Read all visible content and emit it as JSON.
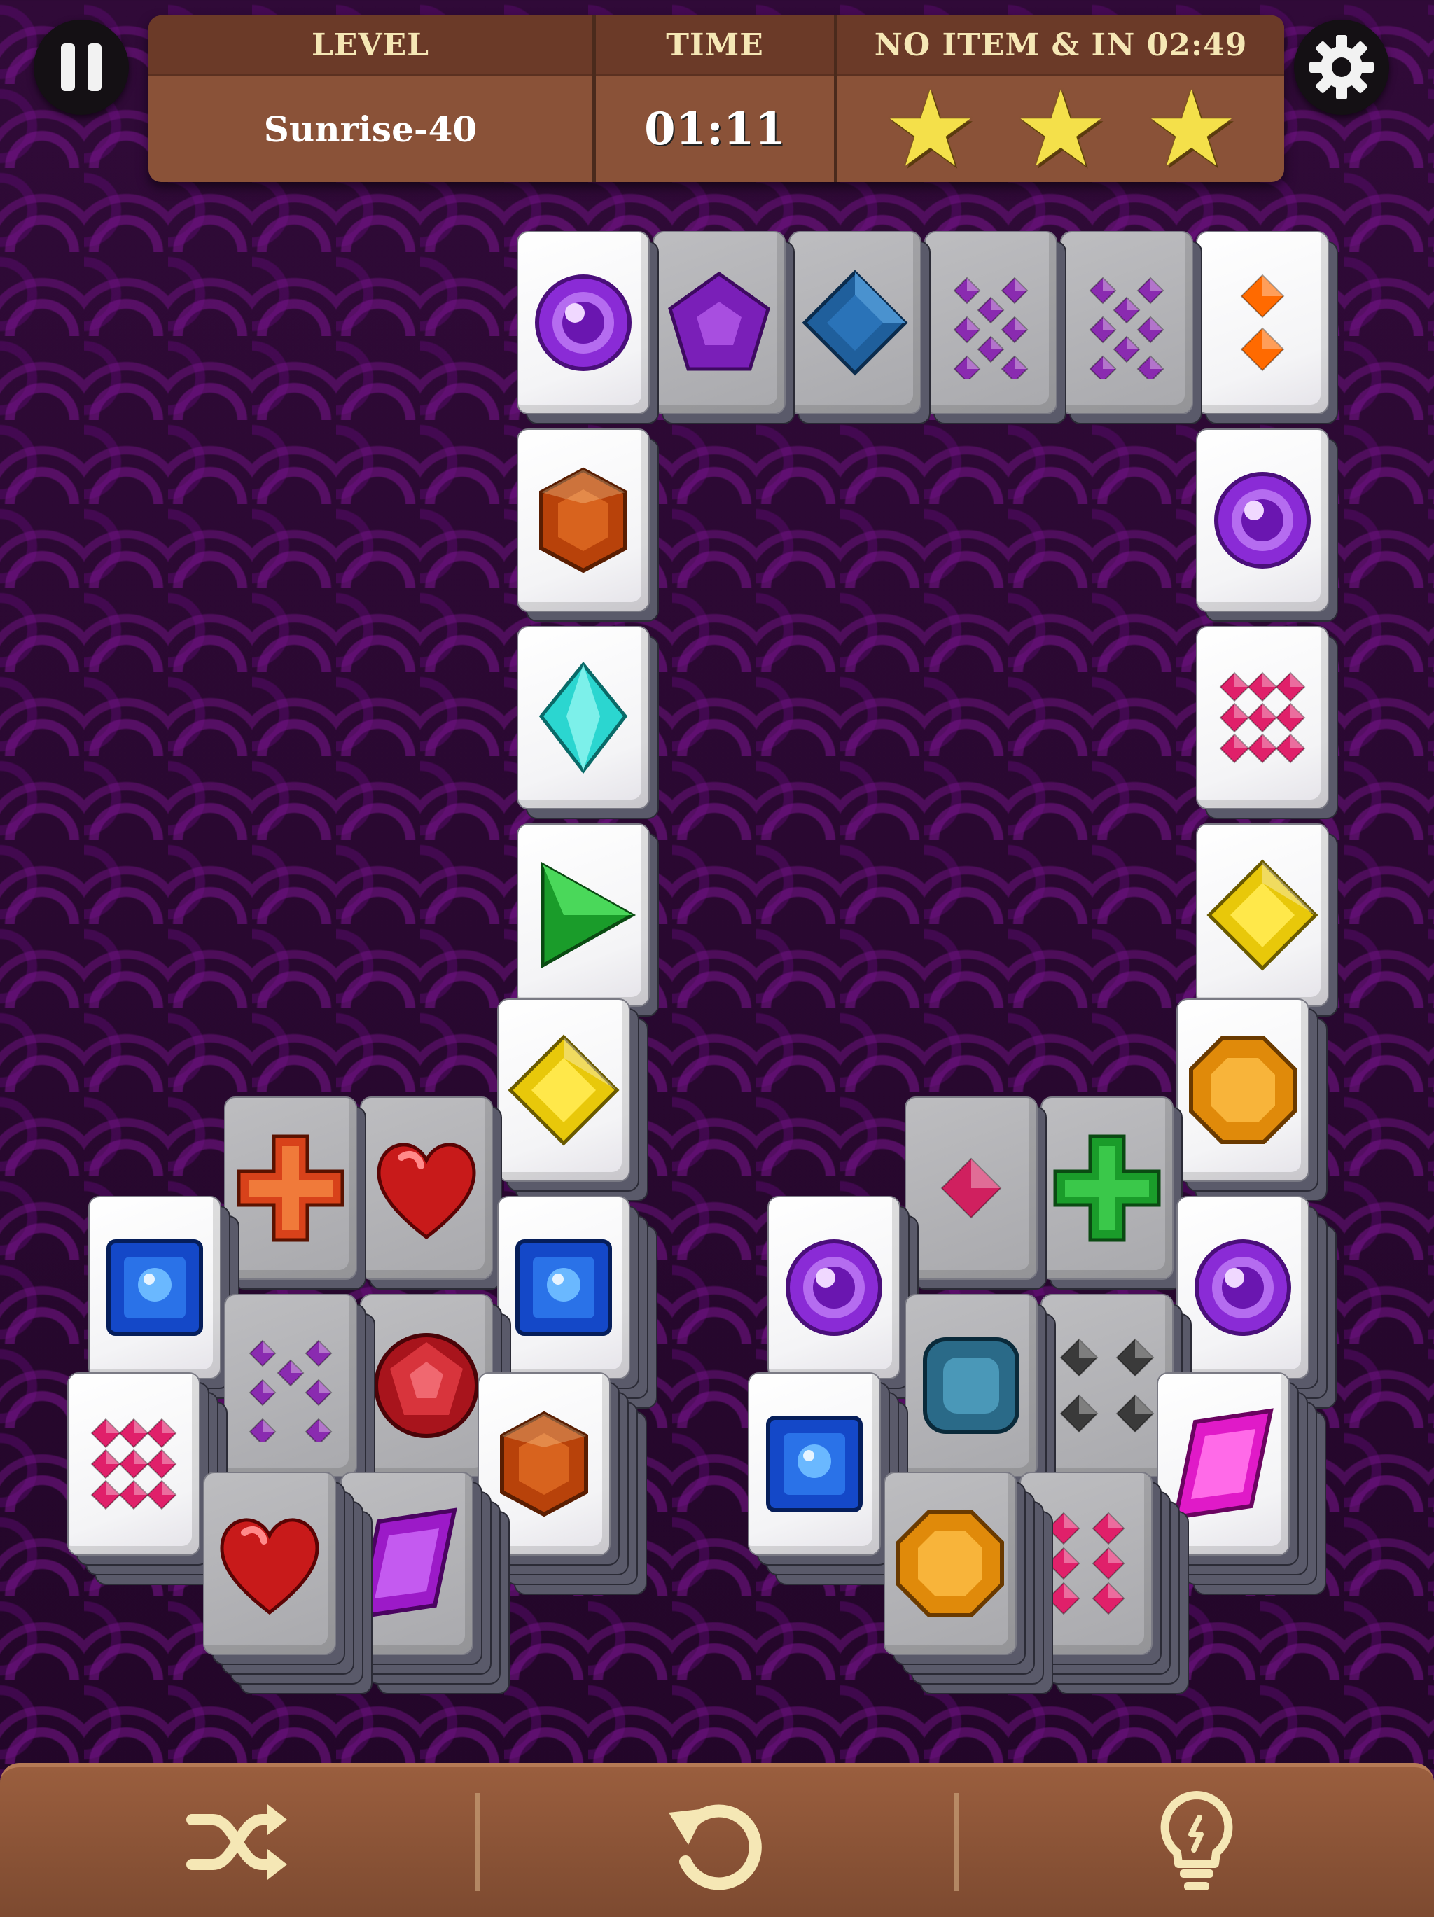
{
  "hud": {
    "level_label": "LEVEL",
    "level_value": "Sunrise-40",
    "time_label": "TIME",
    "time_value": "01:11",
    "goal_label": "NO ITEM & IN 02:49",
    "stars_earned": 3
  },
  "icons": {
    "pause": "pause-icon",
    "settings": "gear-icon",
    "shuffle": "shuffle-icon",
    "undo": "undo-icon",
    "hint": "lightbulb-icon"
  },
  "colors": {
    "hud_bg": "#8a5238",
    "hud_header": "#6b3a28",
    "star": "#f4e04a",
    "toolbar": "#8a5238",
    "toolbar_icon": "#f5e7b5",
    "background": "#2a0a30"
  },
  "board": {
    "tiles": [
      {
        "gem": "purple-orb",
        "state": "free",
        "depth": 1
      },
      {
        "gem": "purple-pentagon",
        "state": "blocked",
        "depth": 1
      },
      {
        "gem": "blue-diamond",
        "state": "blocked",
        "depth": 1
      },
      {
        "gem": "purple-dots-8",
        "state": "blocked",
        "depth": 1
      },
      {
        "gem": "purple-dots-8",
        "state": "blocked",
        "depth": 1
      },
      {
        "gem": "orange-dots-2",
        "state": "free",
        "depth": 1
      },
      {
        "gem": "orange-hexagon",
        "state": "free",
        "depth": 1
      },
      {
        "gem": "purple-orb",
        "state": "free",
        "depth": 1
      },
      {
        "gem": "cyan-crystal",
        "state": "free",
        "depth": 1
      },
      {
        "gem": "pink-dots-9",
        "state": "free",
        "depth": 1
      },
      {
        "gem": "green-triangle",
        "state": "free",
        "depth": 1
      },
      {
        "gem": "yellow-diamond",
        "state": "free",
        "depth": 1
      },
      {
        "gem": "yellow-diamond",
        "state": "free",
        "depth": 2
      },
      {
        "gem": "amber-octagon",
        "state": "free",
        "depth": 2
      },
      {
        "gem": "red-cross",
        "state": "blocked",
        "depth": 1
      },
      {
        "gem": "red-heart",
        "state": "blocked",
        "depth": 1
      },
      {
        "gem": "blue-square",
        "state": "free",
        "depth": 2
      },
      {
        "gem": "blue-square",
        "state": "free",
        "depth": 3
      },
      {
        "gem": "purple-dots-7",
        "state": "blocked",
        "depth": 2
      },
      {
        "gem": "red-round",
        "state": "blocked",
        "depth": 2
      },
      {
        "gem": "pink-dots-9",
        "state": "free",
        "depth": 3
      },
      {
        "gem": "orange-hexagon",
        "state": "free",
        "depth": 4
      },
      {
        "gem": "red-heart",
        "state": "blocked",
        "depth": 4
      },
      {
        "gem": "purple-rhombus",
        "state": "blocked",
        "depth": 4
      },
      {
        "gem": "pink-dots-1",
        "state": "blocked",
        "depth": 1
      },
      {
        "gem": "green-cross",
        "state": "blocked",
        "depth": 1
      },
      {
        "gem": "purple-orb",
        "state": "free",
        "depth": 2
      },
      {
        "gem": "purple-orb",
        "state": "free",
        "depth": 3
      },
      {
        "gem": "teal-square",
        "state": "blocked",
        "depth": 2
      },
      {
        "gem": "gray-dots-4",
        "state": "blocked",
        "depth": 2
      },
      {
        "gem": "blue-square",
        "state": "free",
        "depth": 3
      },
      {
        "gem": "magenta-rhombus",
        "state": "free",
        "depth": 4
      },
      {
        "gem": "amber-octagon",
        "state": "blocked",
        "depth": 4
      },
      {
        "gem": "pink-dots-6",
        "state": "blocked",
        "depth": 4
      }
    ]
  }
}
